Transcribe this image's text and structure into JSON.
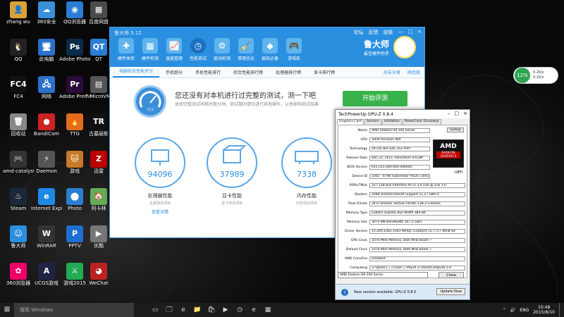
{
  "desktop": {
    "icons": [
      {
        "label": "zhang wu",
        "glyph": "👤",
        "color": "#d8a23a"
      },
      {
        "label": "360安全",
        "glyph": "☁",
        "color": "#3a8fd9"
      },
      {
        "label": "QQ浏览器",
        "glyph": "◉",
        "color": "#2a7cd4"
      },
      {
        "label": "百度网盘",
        "glyph": "▦",
        "color": "#4a4a4a"
      },
      {
        "label": "QQ",
        "glyph": "🐧",
        "color": "#222"
      },
      {
        "label": "此电脑",
        "glyph": "🖥",
        "color": "#2b70c9"
      },
      {
        "label": "Adobe Photoshop",
        "glyph": "Ps",
        "color": "#0b2b4a"
      },
      {
        "label": "QT",
        "glyph": "QT",
        "color": "#2a7fd4"
      },
      {
        "label": "FC4",
        "glyph": "FC4",
        "color": "#111"
      },
      {
        "label": "网络",
        "glyph": "🖧",
        "color": "#2b70c9"
      },
      {
        "label": "Adobe Premiere",
        "glyph": "Pr",
        "color": "#2a0b3a"
      },
      {
        "label": "7 MicroVMI",
        "glyph": "▤",
        "color": "#555"
      },
      {
        "label": "回收站",
        "glyph": "🗑",
        "color": "#888"
      },
      {
        "label": "BandiCam",
        "glyph": "●",
        "color": "#c22"
      },
      {
        "label": "TTG",
        "glyph": "🔥",
        "color": "#e36b1b"
      },
      {
        "label": "古墓丽影",
        "glyph": "TR",
        "color": "#111"
      },
      {
        "label": "amd-catalyst",
        "glyph": "🎮",
        "color": "#333"
      },
      {
        "label": "Daemon",
        "glyph": "⚡",
        "color": "#555"
      },
      {
        "label": "游戏",
        "glyph": "🐱",
        "color": "#c77a2a"
      },
      {
        "label": "迅雷",
        "glyph": "Z",
        "color": "#b00"
      },
      {
        "label": "Steam",
        "glyph": "♨",
        "color": "#1b2838"
      },
      {
        "label": "Internet Explorer",
        "glyph": "e",
        "color": "#1e88e5"
      },
      {
        "label": "Photo",
        "glyph": "⬤",
        "color": "#2a7fd4"
      },
      {
        "label": "阿卡林",
        "glyph": "🏠",
        "color": "#6a5"
      },
      {
        "label": "鲁大师",
        "glyph": "☺",
        "color": "#2b8fe0"
      },
      {
        "label": "WinRAR",
        "glyph": "W",
        "color": "#333"
      },
      {
        "label": "PPTV",
        "glyph": "P",
        "color": "#1d6fd1"
      },
      {
        "label": "优酷",
        "glyph": "▶",
        "color": "#777"
      },
      {
        "label": "360浏览器",
        "glyph": "✿",
        "color": "#e06"
      },
      {
        "label": "UCGS游戏",
        "glyph": "A",
        "color": "#224"
      },
      {
        "label": "游戏2015",
        "glyph": "⚔",
        "color": "#2a5"
      },
      {
        "label": "WeChat",
        "glyph": "◕",
        "color": "#b22"
      }
    ]
  },
  "ludashi": {
    "title": "鲁大师 5.12",
    "controls": [
      "论坛",
      "反馈",
      "皮肤",
      "—",
      "□",
      "×"
    ],
    "nav": [
      {
        "label": "硬件体检",
        "glyph": "✚",
        "active": false
      },
      {
        "label": "硬件检测",
        "glyph": "▦",
        "active": false
      },
      {
        "label": "温度管理",
        "glyph": "📈",
        "active": false
      },
      {
        "label": "性能测试",
        "glyph": "◷",
        "active": true
      },
      {
        "label": "驱动检测",
        "glyph": "⚙",
        "active": false
      },
      {
        "label": "清理优化",
        "glyph": "🧹",
        "active": false
      },
      {
        "label": "装机必备",
        "glyph": "◆",
        "active": false
      },
      {
        "label": "游戏库",
        "glyph": "🎮",
        "active": false
      }
    ],
    "brand": {
      "name": "鲁大师",
      "sub": "最佳硬件助手"
    },
    "tabs": [
      "电脑综合性能评分",
      "手机跑分",
      "手机性能排行",
      "综合性能排行榜",
      "处理器排行榜",
      "显卡排行榜"
    ],
    "tabs_right": [
      "好友分享",
      "网页版"
    ],
    "banner": {
      "message": "您还没有对本机进行过完整的测试，测一下吧",
      "sub": "体验完整测试将耗时数分钟，测试期间请勿进行其他操作，以免影响测试结果",
      "start": "开始评测"
    },
    "scores": [
      {
        "value": "94096",
        "label": "处理器性能",
        "sub": "主频测试项目",
        "link": "查看详情"
      },
      {
        "value": "37989",
        "label": "显卡性能",
        "sub": "显卡测试项目"
      },
      {
        "value": "7338",
        "label": "内存性能",
        "sub": "内存测试项目"
      }
    ]
  },
  "gpuz": {
    "title": "TechPowerUp GPU-Z 0.8.4",
    "tabs": [
      "Graphics Card",
      "Sensors",
      "Validation",
      "PowerColor Giveaway"
    ],
    "rows": [
      {
        "k": "Name",
        "v": "AMD Radeon R9 200 Series"
      },
      {
        "k": "GPU",
        "v": "Tahiti        Revision  N/A"
      },
      {
        "k": "Technology",
        "v": "28 nm      Die Size  352 mm²"
      },
      {
        "k": "Release Date",
        "v": "Dec 22, 2011    Transistors  4313M"
      },
      {
        "k": "BIOS Version",
        "v": "015.015.000.000.000000"
      },
      {
        "k": "Device ID",
        "v": "1002 - 6798    Subvendor  ASUS (1043)"
      },
      {
        "k": "ROPs/TMUs",
        "v": "32 / 128    Bus Interface  PCI-E 3.0 x16 @ x16 3.0"
      },
      {
        "k": "Shaders",
        "v": "2048 Unified    DirectX Support  11.2 / SM5.0"
      },
      {
        "k": "Pixel Fillrate",
        "v": "34.6 GPixel/s    Texture Fillrate  138.2 GTexel/s"
      },
      {
        "k": "Memory Type",
        "v": "GDDR5 (Elpida)    Bus Width  384 Bit"
      },
      {
        "k": "Memory Size",
        "v": "3072 MB    Bandwidth  307.2 GB/s"
      },
      {
        "k": "Driver Version",
        "v": "15.200.1062.1003 WHQL (Catalyst 15.7.1) / Win8 64"
      },
      {
        "k": "GPU Clock",
        "v": "1070 MHz  Memory  1600 MHz  Boost  —"
      },
      {
        "k": "Default Clock",
        "v": "1070 MHz  Memory  1600 MHz  Boost  —"
      },
      {
        "k": "AMD CrossFire",
        "v": "Disabled"
      },
      {
        "k": "Computing",
        "v": "☑ OpenCL  ☐ CUDA  ☐ PhysX  ☑ DirectCompute 5.0"
      }
    ],
    "lookup": "Lookup",
    "uefi": "UEFI",
    "amd": {
      "logo": "AMD",
      "radeon": "RADEON GRAPHICS"
    },
    "selected": "AMD Radeon R9 200 Series",
    "close": "Close",
    "notice": "New version available: GPU-Z 0.8.5",
    "update": "Update Now"
  },
  "widget": {
    "percent": "12%",
    "up": "0.2K/s",
    "down": "0.1K/s"
  },
  "taskbar": {
    "search": "搜索 Windows",
    "items": [
      "▭",
      "🗔",
      "e",
      "📁",
      "🛍",
      "▶",
      "◷",
      "e",
      "▦"
    ],
    "tray": [
      "⌃",
      "🔊",
      "ENG"
    ],
    "time": "10:48",
    "date": "2015/8/10"
  }
}
